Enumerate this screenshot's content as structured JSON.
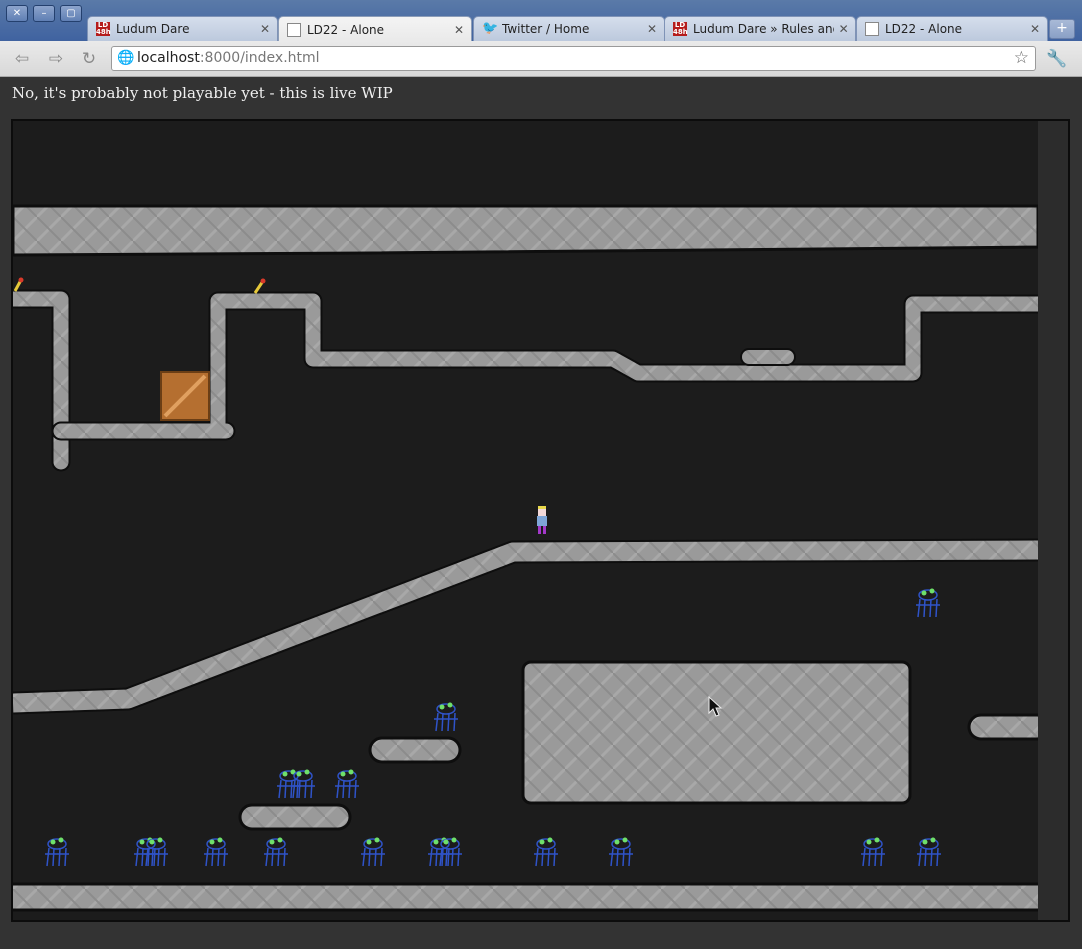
{
  "window_controls": [
    "✕",
    "–",
    "▢"
  ],
  "tabs": [
    {
      "label": "Ludum Dare",
      "favicon": "ludum-dare-icon",
      "active": false
    },
    {
      "label": "LD22 - Alone",
      "favicon": "page-icon",
      "active": true
    },
    {
      "label": "Twitter / Home",
      "favicon": "twitter-bird-icon",
      "active": false
    },
    {
      "label": "Ludum Dare » Rules and C",
      "favicon": "ludum-dare-icon",
      "active": false
    },
    {
      "label": "LD22 - Alone",
      "favicon": "page-icon",
      "active": false
    }
  ],
  "favicon_text": "LD 48h",
  "address_bar": {
    "host": "localhost",
    "rest": ":8000/index.html"
  },
  "page": {
    "status_text": "No, it's probably not playable yet - this is live WIP"
  },
  "game": {
    "background": "#1c1c1c",
    "platform_color": "#9a9a9a",
    "crate_color": "#b56f30",
    "player_colors": {
      "hair": "#e8d84a",
      "shirt": "#7fa6d8",
      "legs": "#a338c9"
    },
    "enemy_color": "#2f53c8",
    "enemy_eye_color": "#6fe06a"
  }
}
